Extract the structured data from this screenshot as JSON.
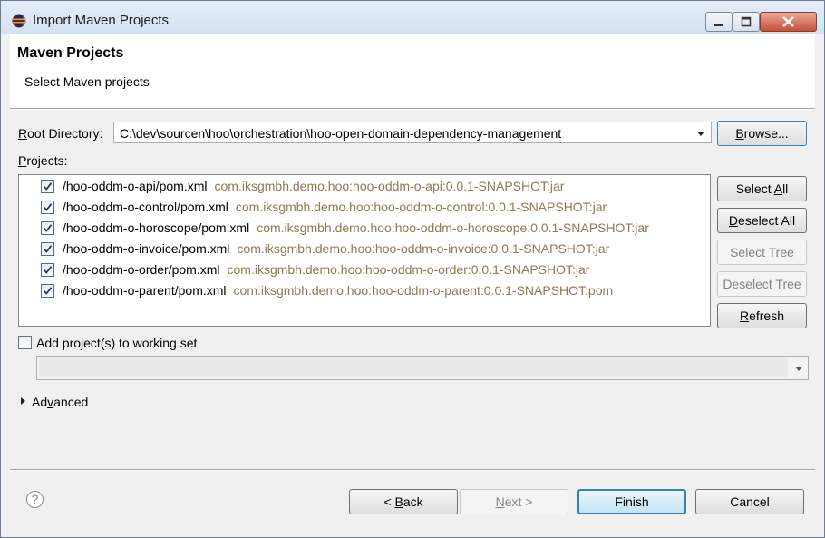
{
  "window": {
    "title": "Import Maven Projects",
    "app_icon": "eclipse-icon",
    "controls": [
      "minimize-icon",
      "maximize-icon",
      "close-icon"
    ]
  },
  "banner": {
    "title": "Maven Projects",
    "subtitle": "Select Maven projects"
  },
  "root_directory": {
    "label_before": "",
    "label_mnemonic": "R",
    "label_after": "oot Directory:",
    "value": "C:\\dev\\sourcen\\hoo\\orchestration\\hoo-open-domain-dependency-management",
    "browse_mnemonic": "B",
    "browse_rest": "rowse..."
  },
  "projects": {
    "label_mnemonic": "P",
    "label_rest": "rojects:",
    "items": [
      {
        "path": "/hoo-oddm-o-api/pom.xml",
        "coords": "com.iksgmbh.demo.hoo:hoo-oddm-o-api:0.0.1-SNAPSHOT:jar",
        "checked": true
      },
      {
        "path": "/hoo-oddm-o-control/pom.xml",
        "coords": "com.iksgmbh.demo.hoo:hoo-oddm-o-control:0.0.1-SNAPSHOT:jar",
        "checked": true
      },
      {
        "path": "/hoo-oddm-o-horoscope/pom.xml",
        "coords": "com.iksgmbh.demo.hoo:hoo-oddm-o-horoscope:0.0.1-SNAPSHOT:jar",
        "checked": true
      },
      {
        "path": "/hoo-oddm-o-invoice/pom.xml",
        "coords": "com.iksgmbh.demo.hoo:hoo-oddm-o-invoice:0.0.1-SNAPSHOT:jar",
        "checked": true
      },
      {
        "path": "/hoo-oddm-o-order/pom.xml",
        "coords": "com.iksgmbh.demo.hoo:hoo-oddm-o-order:0.0.1-SNAPSHOT:jar",
        "checked": true
      },
      {
        "path": "/hoo-oddm-o-parent/pom.xml",
        "coords": "com.iksgmbh.demo.hoo:hoo-oddm-o-parent:0.0.1-SNAPSHOT:pom",
        "checked": true
      }
    ]
  },
  "side_buttons": {
    "select_all_before": "Select ",
    "select_all_mnemonic": "A",
    "select_all_after": "ll",
    "deselect_all_mnemonic": "D",
    "deselect_all_rest": "eselect All",
    "select_tree": "Select Tree",
    "deselect_tree": "Deselect Tree",
    "refresh_mnemonic": "R",
    "refresh_rest": "efresh"
  },
  "working_set": {
    "label": "Add project(s) to working set",
    "checked": false,
    "value": ""
  },
  "advanced": {
    "label_before": "Ad",
    "label_mnemonic": "v",
    "label_after": "anced"
  },
  "footer": {
    "help": "?",
    "back_prefix": "< ",
    "back_mnemonic": "B",
    "back_rest": "ack",
    "next_before": "",
    "next_mnemonic": "N",
    "next_rest": "ext >",
    "finish": "Finish",
    "cancel": "Cancel"
  },
  "colors": {
    "coords_text": "#8d7b52",
    "default_button_border": "#3c7fb1"
  }
}
